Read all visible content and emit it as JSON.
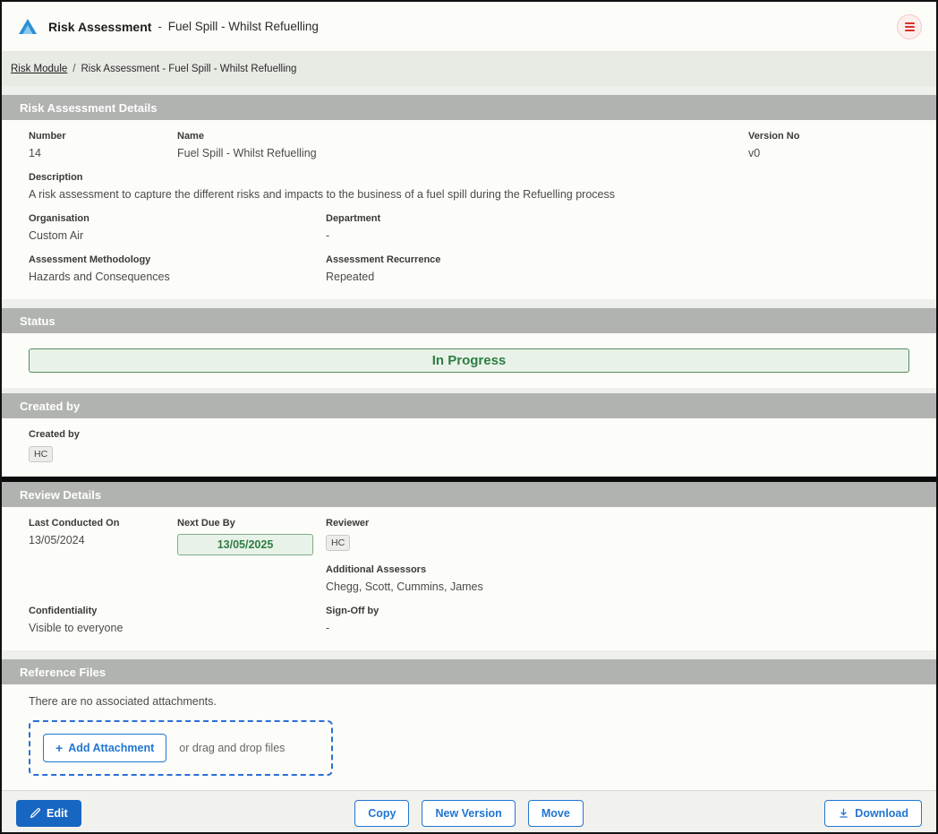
{
  "colors": {
    "accent_blue": "#1766c2",
    "outline_blue": "#2176d2",
    "status_green": "#2e7d43",
    "status_green_bg": "#e9f2e9",
    "section_header_gray": "#b1b3b0",
    "menu_icon_red": "#d93025"
  },
  "header": {
    "app_title": "Risk Assessment",
    "separator": "-",
    "subtitle": "Fuel Spill - Whilst Refuelling"
  },
  "breadcrumb": {
    "link": "Risk Module",
    "separator": "/",
    "current": "Risk Assessment - Fuel Spill - Whilst Refuelling"
  },
  "details": {
    "section_title": "Risk Assessment Details",
    "fields": {
      "number_label": "Number",
      "number_value": "14",
      "name_label": "Name",
      "name_value": "Fuel Spill - Whilst Refuelling",
      "version_label": "Version No",
      "version_value": "v0",
      "description_label": "Description",
      "description_value": "A risk assessment to capture the different risks and impacts to the business of a fuel spill during the Refuelling process",
      "organisation_label": "Organisation",
      "organisation_value": "Custom Air",
      "department_label": "Department",
      "department_value": "-",
      "methodology_label": "Assessment Methodology",
      "methodology_value": "Hazards and Consequences",
      "recurrence_label": "Assessment Recurrence",
      "recurrence_value": "Repeated"
    }
  },
  "status": {
    "section_title": "Status",
    "value": "In Progress"
  },
  "created_by": {
    "section_title": "Created by",
    "label": "Created by",
    "value": "HC"
  },
  "review": {
    "section_title": "Review Details",
    "last_conducted_label": "Last Conducted On",
    "last_conducted_value": "13/05/2024",
    "next_due_label": "Next Due By",
    "next_due_value": "13/05/2025",
    "reviewer_label": "Reviewer",
    "reviewer_value": "HC",
    "additional_assessors_label": "Additional Assessors",
    "additional_assessors_value": "Chegg, Scott, Cummins, James",
    "confidentiality_label": "Confidentiality",
    "confidentiality_value": "Visible to everyone",
    "signoff_label": "Sign-Off by",
    "signoff_value": "-"
  },
  "reference_files": {
    "section_title": "Reference Files",
    "empty_text": "There are no associated attachments.",
    "add_button": "Add Attachment",
    "drag_text": "or drag and drop files"
  },
  "footer": {
    "edit": "Edit",
    "copy": "Copy",
    "new_version": "New Version",
    "move": "Move",
    "download": "Download"
  }
}
